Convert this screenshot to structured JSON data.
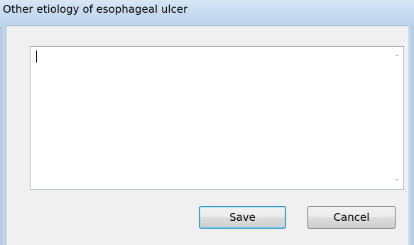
{
  "window": {
    "title": "Other etiology of esophageal ulcer"
  },
  "editor": {
    "value": ""
  },
  "buttons": {
    "save_label": "Save",
    "cancel_label": "Cancel"
  },
  "icons": {
    "scroll_up": "scroll-up-arrow-icon",
    "scroll_down": "scroll-down-arrow-icon"
  },
  "colors": {
    "titlebar": "#c9dcf0",
    "client_background": "#f0f0f0",
    "default_button_border": "#3c7fb1"
  }
}
